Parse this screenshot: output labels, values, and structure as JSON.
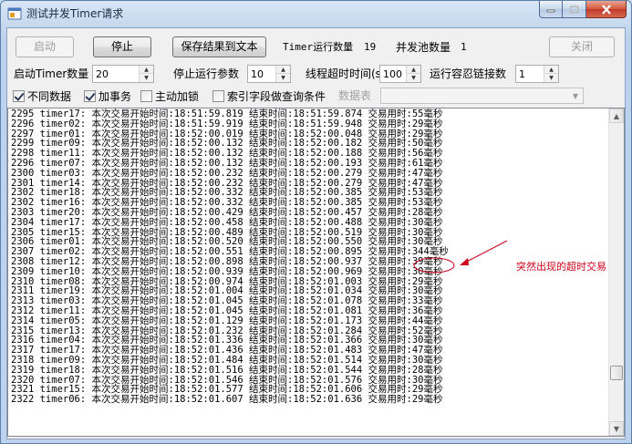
{
  "window": {
    "title": "测试并发Timer请求",
    "controls": [
      "minimize",
      "maximize",
      "close"
    ]
  },
  "toolbar": {
    "start_label": "启动",
    "stop_label": "停止",
    "save_label": "保存结果到文本",
    "timer_count_label": "Timer运行数量",
    "timer_count_value": "19",
    "pool_count_label": "并发池数量",
    "pool_count_value": "1",
    "close_label": "关闭"
  },
  "params": {
    "start_timer_label": "启动Timer数量",
    "start_timer_value": "20",
    "stop_param_label": "停止运行参数",
    "stop_param_value": "10",
    "thread_timeout_label": "线程超时时间(s",
    "thread_timeout_value": "100",
    "tolerance_label": "运行容忍链接数",
    "tolerance_value": "1"
  },
  "options": {
    "diff_data_label": "不同数据",
    "diff_data_checked": true,
    "transaction_label": "加事务",
    "transaction_checked": true,
    "lock_label": "主动加锁",
    "lock_checked": false,
    "index_label": "索引字段做查询条件",
    "index_checked": false,
    "table_label": "数据表",
    "table_value": ""
  },
  "log": [
    {
      "n": "2295",
      "timer": "timer17",
      "start": "18:51:59.819",
      "end": "18:51:59.874",
      "ms": "55"
    },
    {
      "n": "2296",
      "timer": "timer02",
      "start": "18:51:59.919",
      "end": "18:51:59.948",
      "ms": "29"
    },
    {
      "n": "2297",
      "timer": "timer01",
      "start": "18:52:00.019",
      "end": "18:52:00.048",
      "ms": "29"
    },
    {
      "n": "2299",
      "timer": "timer09",
      "start": "18:52:00.132",
      "end": "18:52:00.182",
      "ms": "50"
    },
    {
      "n": "2298",
      "timer": "timer11",
      "start": "18:52:00.132",
      "end": "18:52:00.188",
      "ms": "56"
    },
    {
      "n": "2296",
      "timer": "timer07",
      "start": "18:52:00.132",
      "end": "18:52:00.193",
      "ms": "61"
    },
    {
      "n": "2300",
      "timer": "timer03",
      "start": "18:52:00.232",
      "end": "18:52:00.279",
      "ms": "47"
    },
    {
      "n": "2301",
      "timer": "timer14",
      "start": "18:52:00.232",
      "end": "18:52:00.279",
      "ms": "47"
    },
    {
      "n": "2302",
      "timer": "timer18",
      "start": "18:52:00.332",
      "end": "18:52:00.385",
      "ms": "53"
    },
    {
      "n": "2302",
      "timer": "timer16",
      "start": "18:52:00.332",
      "end": "18:52:00.385",
      "ms": "53"
    },
    {
      "n": "2303",
      "timer": "timer20",
      "start": "18:52:00.429",
      "end": "18:52:00.457",
      "ms": "28"
    },
    {
      "n": "2304",
      "timer": "timer17",
      "start": "18:52:00.458",
      "end": "18:52:00.488",
      "ms": "30"
    },
    {
      "n": "2305",
      "timer": "timer15",
      "start": "18:52:00.489",
      "end": "18:52:00.519",
      "ms": "30"
    },
    {
      "n": "2306",
      "timer": "timer01",
      "start": "18:52:00.520",
      "end": "18:52:00.550",
      "ms": "30"
    },
    {
      "n": "2307",
      "timer": "timer02",
      "start": "18:52:00.551",
      "end": "18:52:00.895",
      "ms": "344"
    },
    {
      "n": "2308",
      "timer": "timer12",
      "start": "18:52:00.898",
      "end": "18:52:00.937",
      "ms": "39"
    },
    {
      "n": "2309",
      "timer": "timer10",
      "start": "18:52:00.939",
      "end": "18:52:00.969",
      "ms": "30"
    },
    {
      "n": "2310",
      "timer": "timer08",
      "start": "18:52:00.974",
      "end": "18:52:01.003",
      "ms": "29"
    },
    {
      "n": "2311",
      "timer": "timer19",
      "start": "18:52:01.004",
      "end": "18:52:01.034",
      "ms": "30"
    },
    {
      "n": "2313",
      "timer": "timer03",
      "start": "18:52:01.045",
      "end": "18:52:01.078",
      "ms": "33"
    },
    {
      "n": "2312",
      "timer": "timer11",
      "start": "18:52:01.045",
      "end": "18:52:01.081",
      "ms": "36"
    },
    {
      "n": "2314",
      "timer": "timer05",
      "start": "18:52:01.129",
      "end": "18:52:01.173",
      "ms": "44"
    },
    {
      "n": "2315",
      "timer": "timer13",
      "start": "18:52:01.232",
      "end": "18:52:01.284",
      "ms": "52"
    },
    {
      "n": "2316",
      "timer": "timer04",
      "start": "18:52:01.336",
      "end": "18:52:01.366",
      "ms": "30"
    },
    {
      "n": "2317",
      "timer": "timer17",
      "start": "18:52:01.436",
      "end": "18:52:01.483",
      "ms": "47"
    },
    {
      "n": "2318",
      "timer": "timer09",
      "start": "18:52:01.484",
      "end": "18:52:01.514",
      "ms": "30"
    },
    {
      "n": "2319",
      "timer": "timer18",
      "start": "18:52:01.516",
      "end": "18:52:01.544",
      "ms": "28"
    },
    {
      "n": "2320",
      "timer": "timer07",
      "start": "18:52:01.546",
      "end": "18:52:01.576",
      "ms": "30"
    },
    {
      "n": "2321",
      "timer": "timer15",
      "start": "18:52:01.577",
      "end": "18:52:01.606",
      "ms": "29"
    },
    {
      "n": "2322",
      "timer": "timer06",
      "start": "18:52:01.607",
      "end": "18:52:01.636",
      "ms": "29"
    }
  ],
  "log_labels": {
    "start": "本次交易开始时间",
    "end": "结束时间",
    "cost": "交易用时",
    "unit": "毫秒"
  },
  "annotation": {
    "text": "突然出现的超时交易",
    "color": "#d0021b"
  }
}
